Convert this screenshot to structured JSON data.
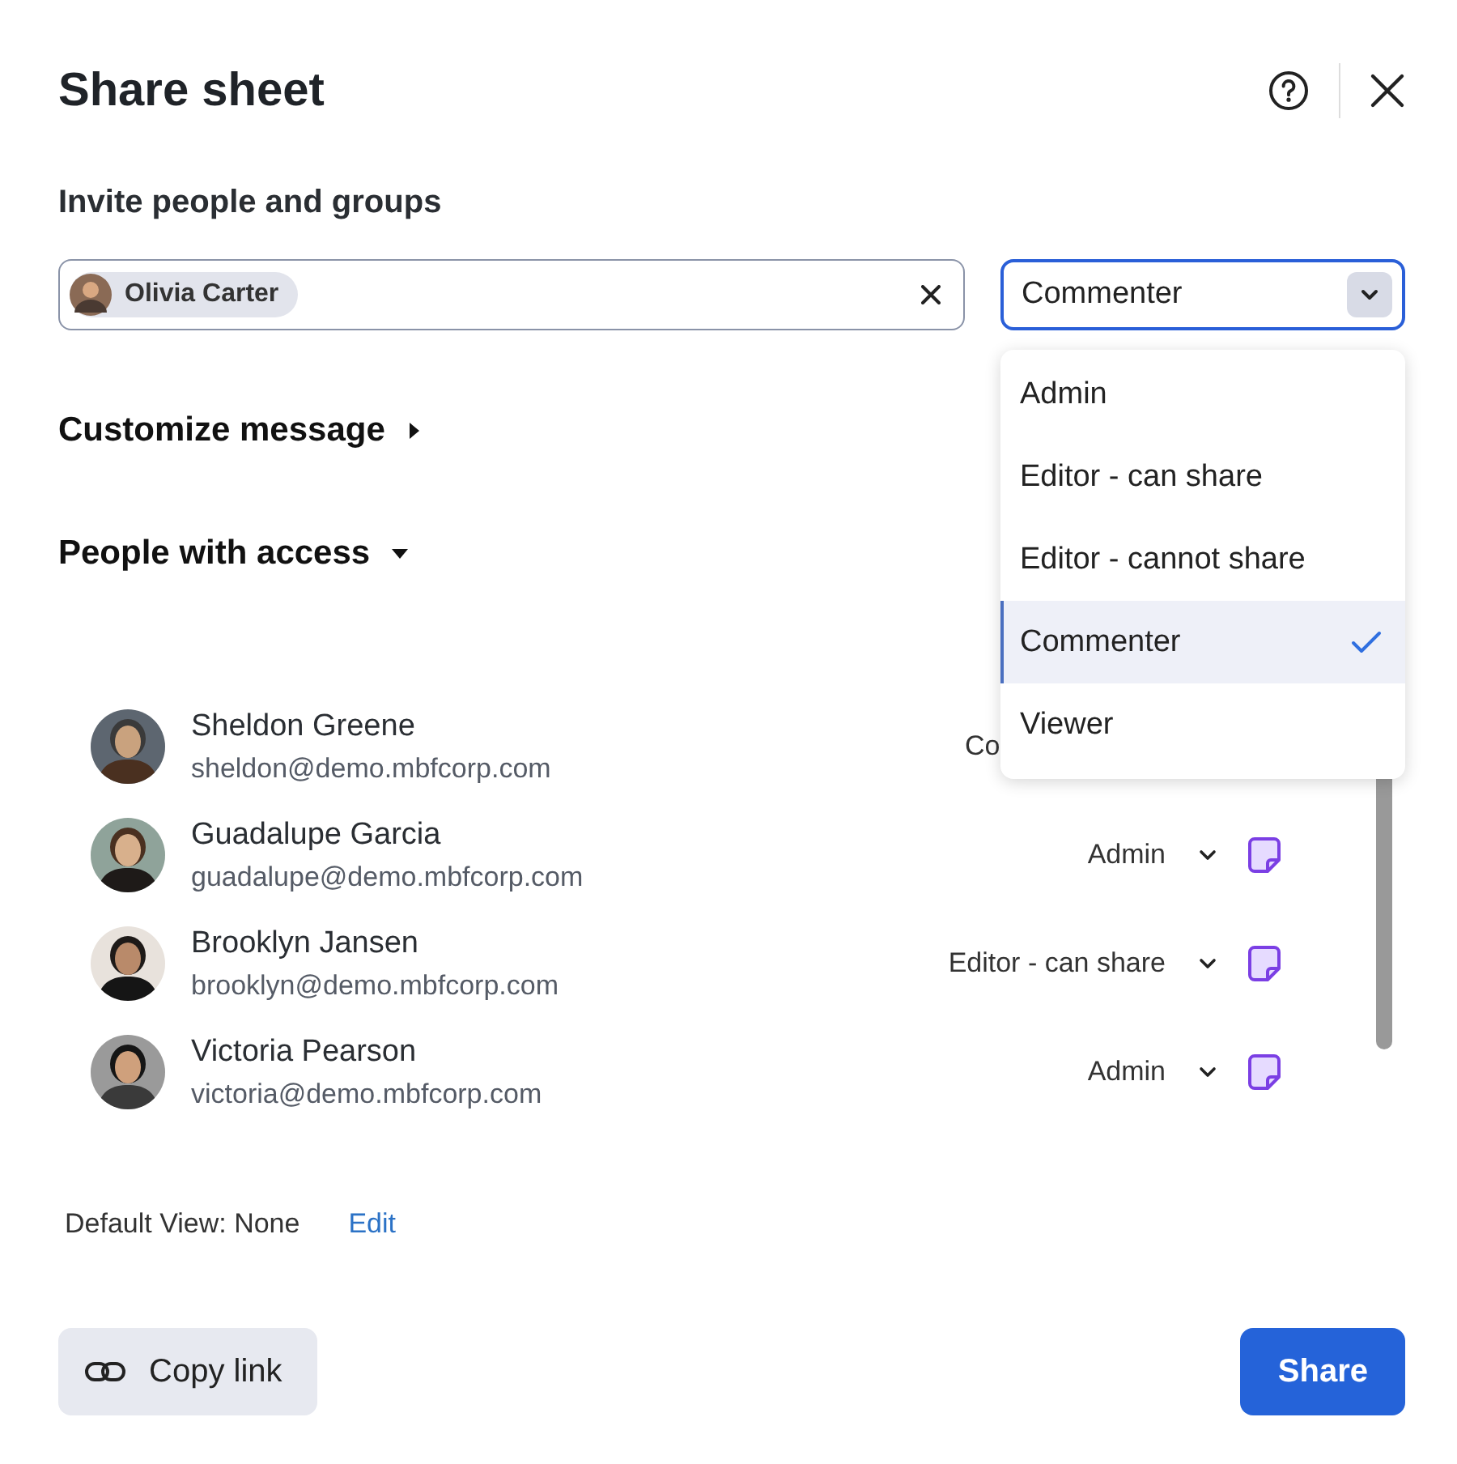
{
  "title": "Share sheet",
  "invite_heading": "Invite people and groups",
  "invitee_chip": {
    "name": "Olivia Carter"
  },
  "role_select": {
    "value": "Commenter",
    "open": true,
    "options": [
      {
        "label": "Admin",
        "selected": false
      },
      {
        "label": "Editor - can share",
        "selected": false
      },
      {
        "label": "Editor - cannot share",
        "selected": false
      },
      {
        "label": "Commenter",
        "selected": true
      },
      {
        "label": "Viewer",
        "selected": false
      }
    ]
  },
  "customize_message": {
    "label": "Customize message",
    "expanded": false
  },
  "people_with_access": {
    "label": "People with access",
    "expanded": true
  },
  "people": [
    {
      "name": "Sheldon Greene",
      "email": "sheldon@demo.mbfcorp.com",
      "role": "Co",
      "role_cut": true
    },
    {
      "name": "Guadalupe Garcia",
      "email": "guadalupe@demo.mbfcorp.com",
      "role": "Admin",
      "role_cut": false
    },
    {
      "name": "Brooklyn Jansen",
      "email": "brooklyn@demo.mbfcorp.com",
      "role": "Editor - can share",
      "role_cut": false
    },
    {
      "name": "Victoria Pearson",
      "email": "victoria@demo.mbfcorp.com",
      "role": "Admin",
      "role_cut": false
    }
  ],
  "default_view": {
    "label": "Default View: None",
    "link": "Edit"
  },
  "copy_link": "Copy link",
  "share": "Share"
}
